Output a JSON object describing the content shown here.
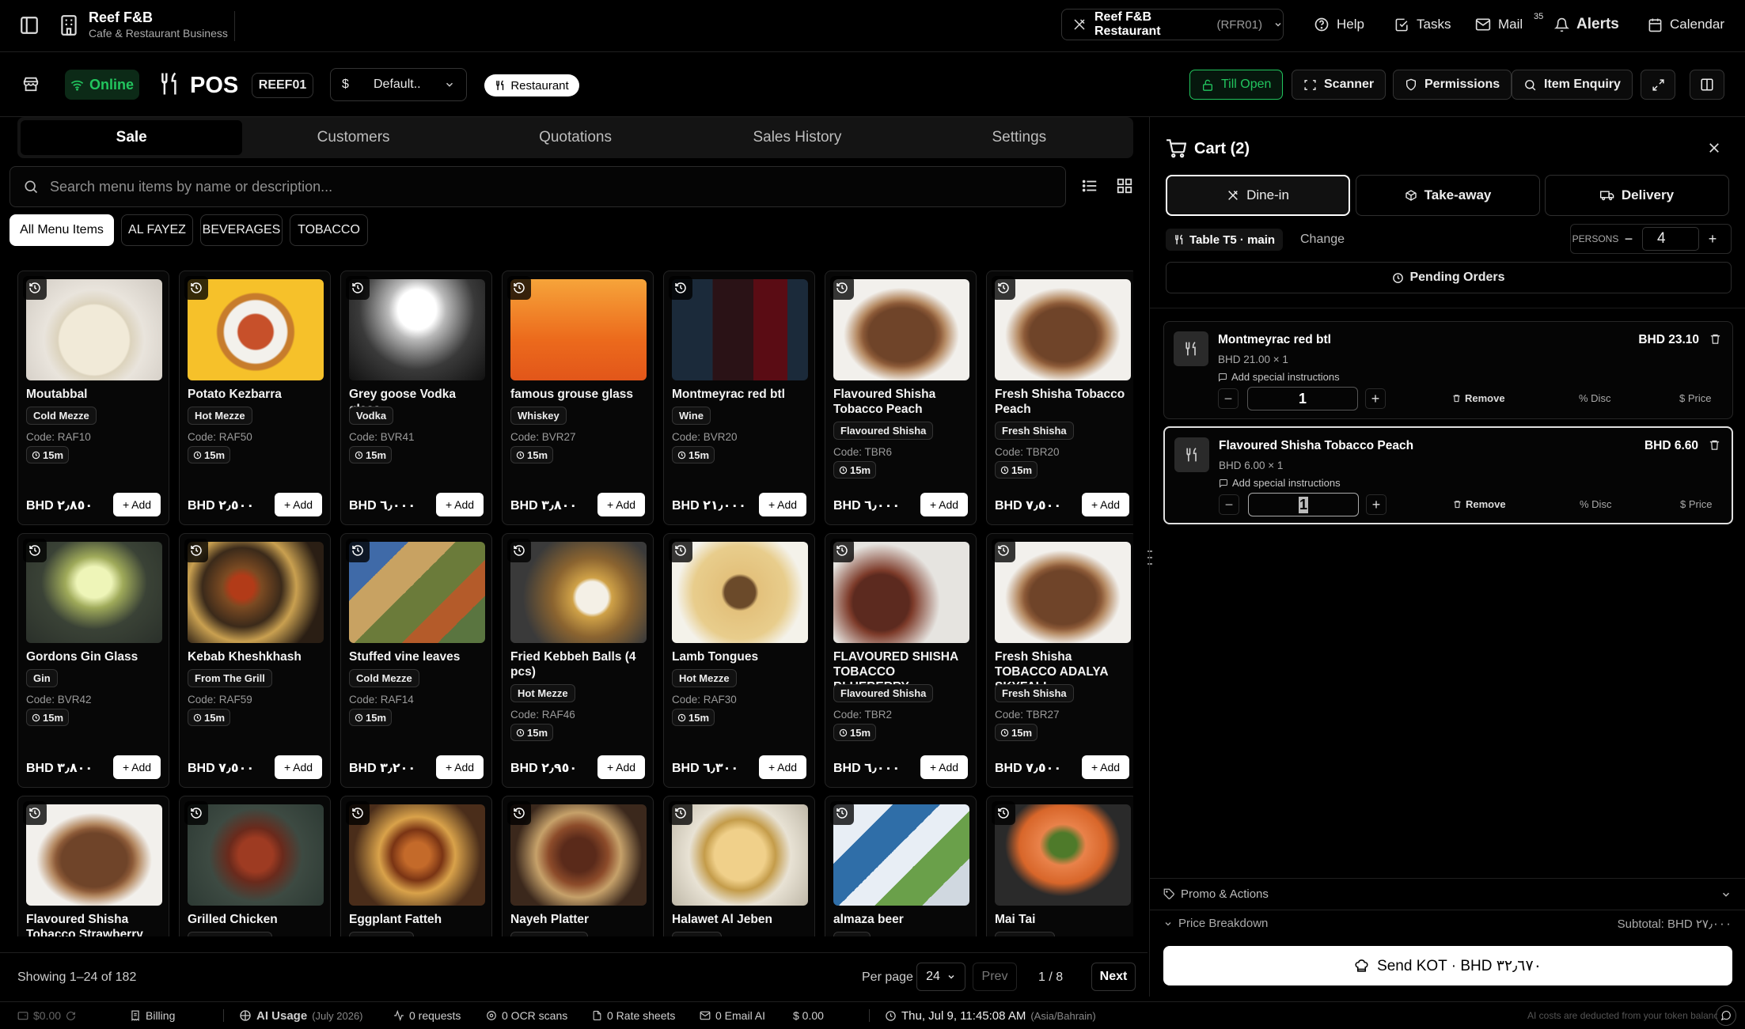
{
  "topbar": {
    "brand_name": "Reef F&B",
    "brand_sub": "Cafe & Restaurant Business",
    "outlet_name": "Reef F&B Restaurant",
    "outlet_code": "(RFR01)",
    "help": "Help",
    "tasks": "Tasks",
    "mail": "Mail",
    "mail_count": "35",
    "alerts": "Alerts",
    "calendar": "Calendar"
  },
  "posbar": {
    "status": "Online",
    "title": "POS",
    "terminal": "REEF01",
    "pricelist_symbol": "$",
    "pricelist": "Default..",
    "mode": "Restaurant",
    "till": "Till Open",
    "scanner": "Scanner",
    "permissions": "Permissions",
    "item_enquiry": "Item Enquiry"
  },
  "tabs": [
    "Sale",
    "Customers",
    "Quotations",
    "Sales History",
    "Settings"
  ],
  "search": {
    "placeholder": "Search menu items by name or description..."
  },
  "categories": [
    "All Menu Items",
    "AL FAYEZ",
    "BEVERAGES",
    "TOBACCO"
  ],
  "add_label": "Add",
  "items": [
    {
      "name": "Moutabbal",
      "cat": "Cold Mezze",
      "code": "Code: RAF10",
      "time": "15m",
      "price": "BHD ٢٫٨٥٠",
      "img": "dip"
    },
    {
      "name": "Potato Kezbarra",
      "cat": "Hot Mezze",
      "code": "Code: RAF50",
      "time": "15m",
      "price": "BHD ٢٫٥٠٠",
      "img": "potato"
    },
    {
      "name": "Grey goose Vodka glass",
      "cat": "Vodka",
      "code": "Code: BVR41",
      "time": "15m",
      "price": "BHD ٦٫٠٠٠",
      "img": "glass"
    },
    {
      "name": "famous grouse glass",
      "cat": "Whiskey",
      "code": "Code: BVR27",
      "time": "15m",
      "price": "BHD ٣٫٨٠٠",
      "img": "orange"
    },
    {
      "name": "Montmeyrac red btl",
      "cat": "Wine",
      "code": "Code: BVR20",
      "time": "15m",
      "price": "BHD ٢١٫٠٠٠",
      "img": "wine"
    },
    {
      "name": "Flavoured Shisha Tobacco Peach",
      "cat": "Flavoured Shisha",
      "code": "Code: TBR6",
      "time": "15m",
      "price": "BHD ٦٫٠٠٠",
      "img": "cigar"
    },
    {
      "name": "Fresh Shisha Tobacco Peach",
      "cat": "Fresh Shisha",
      "code": "Code: TBR20",
      "time": "15m",
      "price": "BHD ٧٫٥٠٠",
      "img": "cigar"
    },
    {
      "name": "Gordons Gin Glass",
      "cat": "Gin",
      "code": "Code: BVR42",
      "time": "15m",
      "price": "BHD ٣٫٨٠٠",
      "img": "gin"
    },
    {
      "name": "Kebab Kheshkhash",
      "cat": "From The Grill",
      "code": "Code: RAF59",
      "time": "15m",
      "price": "BHD ٧٫٥٠٠",
      "img": "grill"
    },
    {
      "name": "Stuffed vine leaves",
      "cat": "Cold Mezze",
      "code": "Code: RAF14",
      "time": "15m",
      "price": "BHD ٣٫٢٠٠",
      "img": "vine"
    },
    {
      "name": "Fried Kebbeh Balls (4 pcs)",
      "cat": "Hot Mezze",
      "code": "Code: RAF46",
      "time": "15m",
      "price": "BHD ٢٫٩٥٠",
      "img": "fries"
    },
    {
      "name": "Lamb Tongues",
      "cat": "Hot Mezze",
      "code": "Code: RAF30",
      "time": "15m",
      "price": "BHD ٦٫٣٠٠",
      "img": "rice"
    },
    {
      "name": "FLAVOURED SHISHA TOBACCO BLUEBERRY",
      "cat": "Flavoured Shisha",
      "code": "Code: TBR2",
      "time": "15m",
      "price": "BHD ٦٫٠٠٠",
      "img": "cigar2"
    },
    {
      "name": "Fresh Shisha TOBACCO ADALYA SKYFALL",
      "cat": "Fresh Shisha",
      "code": "Code: TBR27",
      "time": "15m",
      "price": "BHD ٧٫٥٠٠",
      "img": "cigar"
    },
    {
      "name": "Flavoured Shisha Tobacco Strawberry",
      "cat": "",
      "code": "",
      "time": "",
      "price": "",
      "img": "cigar"
    },
    {
      "name": "Grilled Chicken",
      "cat": "From The Grill",
      "code": "",
      "time": "",
      "price": "",
      "img": "chicken"
    },
    {
      "name": "Eggplant Fatteh",
      "cat": "Hot Mezze",
      "code": "",
      "time": "",
      "price": "",
      "img": "eggplant"
    },
    {
      "name": "Nayeh Platter",
      "cat": "Nayye Mezze",
      "code": "",
      "time": "",
      "price": "",
      "img": "platter"
    },
    {
      "name": "Halawet Al Jeben",
      "cat": "Sweets",
      "code": "",
      "time": "",
      "price": "",
      "img": "noodle"
    },
    {
      "name": "almaza beer",
      "cat": "Beer",
      "code": "",
      "time": "",
      "price": "",
      "img": "beer"
    },
    {
      "name": "Mai Tai",
      "cat": "Cocktails",
      "code": "",
      "time": "",
      "price": "",
      "img": "maitai"
    }
  ],
  "pager": {
    "showing": "Showing 1–24 of 182",
    "per_page_label": "Per page",
    "per_page": "24",
    "prev": "Prev",
    "page": "1 / 8",
    "next": "Next"
  },
  "cart": {
    "title": "Cart (2)",
    "types": [
      "Dine-in",
      "Take-away",
      "Delivery"
    ],
    "table": "Table T5 · main",
    "change": "Change",
    "persons_label": "PERSONS",
    "persons": "4",
    "pending": "Pending Orders",
    "items": [
      {
        "name": "Montmeyrac red btl",
        "total": "BHD 23.10",
        "unit": "BHD 21.00 × 1",
        "instructions": "Add special instructions",
        "qty": "1"
      },
      {
        "name": "Flavoured Shisha Tobacco Peach",
        "total": "BHD 6.60",
        "unit": "BHD 6.00 × 1",
        "instructions": "Add special instructions",
        "qty": "1"
      }
    ],
    "remove": "Remove",
    "disc": "% Disc",
    "price": "$ Price",
    "promo": "Promo & Actions",
    "breakdown": "Price Breakdown",
    "subtotal": "Subtotal: BHD ٢٧٫٠٠٠",
    "send": "Send KOT · BHD ٣٢٫٦٧٠"
  },
  "status": {
    "balance": "$0.00",
    "billing": "Billing",
    "ai_usage": "AI Usage",
    "ai_month": "(July 2026)",
    "requests": "0 requests",
    "ocr": "0 OCR scans",
    "rates": "0 Rate sheets",
    "email_ai": "0 Email AI",
    "cost": "$ 0.00",
    "datetime": "Thu, Jul 9, 11:45:08 AM",
    "tz": "(Asia/Bahrain)",
    "note": "AI costs are deducted from your token balance"
  },
  "colors": {
    "online": "#22c55e",
    "till": "#22c55e",
    "accent": "#ffffff"
  }
}
